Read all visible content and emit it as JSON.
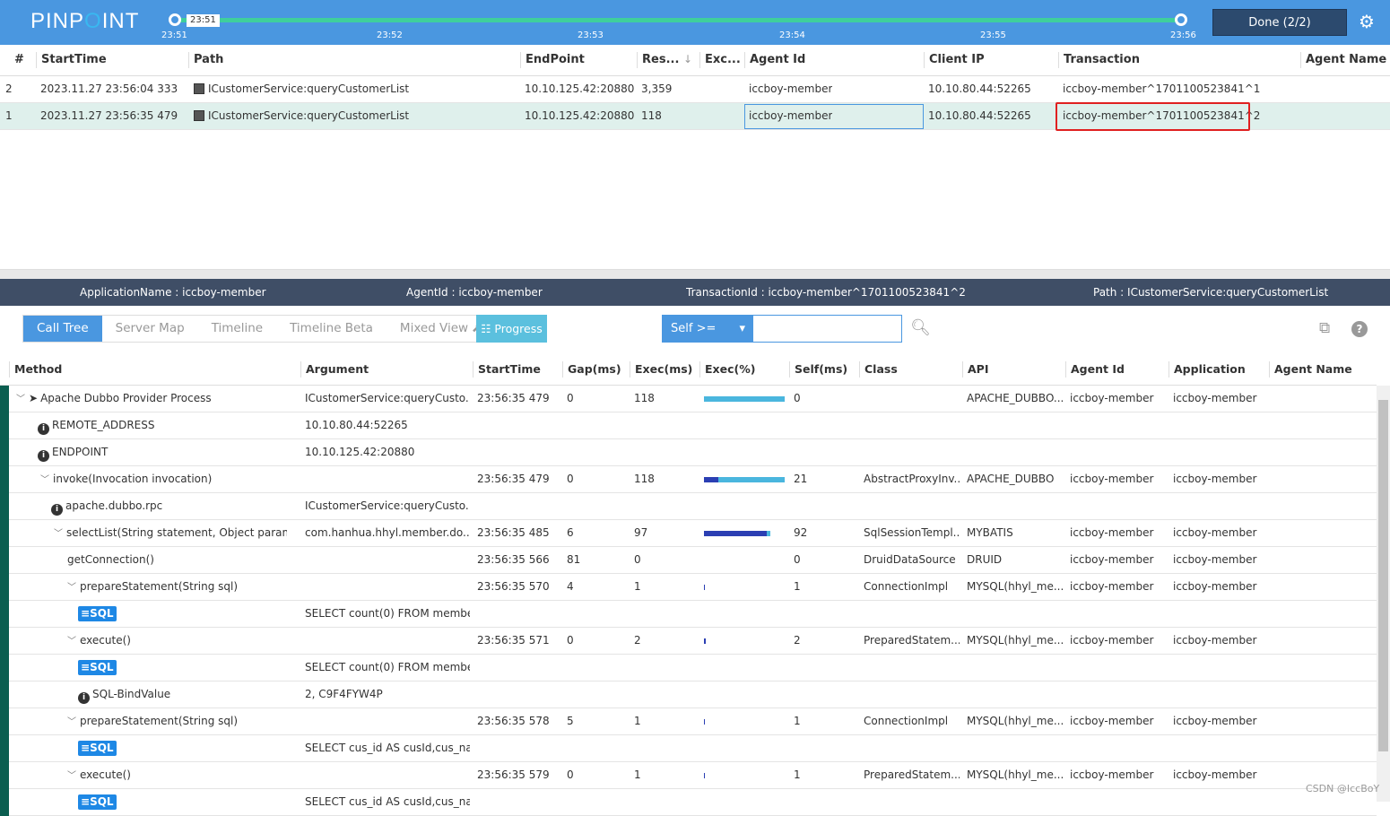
{
  "header": {
    "logo_left": "PINP",
    "logo_o": "O",
    "logo_right": "INT",
    "range_tooltip": "23:51",
    "ticks": [
      "23:51",
      "23:52",
      "23:53",
      "23:54",
      "23:55",
      "23:56"
    ],
    "done_label": "Done (2/2)",
    "accent": "#4a97e0",
    "track_color": "#3fcf9c"
  },
  "list": {
    "columns": [
      "#",
      "StartTime",
      "Path",
      "EndPoint",
      "Res...",
      "Exc...",
      "Agent Id",
      "Client IP",
      "Transaction",
      "Agent Name"
    ],
    "rows": [
      {
        "no": "2",
        "start": "2023.11.27 23:56:04 333",
        "path": "ICustomerService:queryCustomerList",
        "endpoint": "10.10.125.42:20880",
        "res": "3,359",
        "exc": "",
        "agent": "iccboy-member",
        "client": "10.10.80.44:52265",
        "tx": "iccboy-member^1701100523841^1",
        "agentname": ""
      },
      {
        "no": "1",
        "start": "2023.11.27 23:56:35 479",
        "path": "ICustomerService:queryCustomerList",
        "endpoint": "10.10.125.42:20880",
        "res": "118",
        "exc": "",
        "agent": "iccboy-member",
        "client": "10.10.80.44:52265",
        "tx": "iccboy-member^1701100523841^2",
        "agentname": "",
        "selected": true
      }
    ]
  },
  "info": {
    "app": "ApplicationName : iccboy-member",
    "agent": "AgentId : iccboy-member",
    "tx": "TransactionId : iccboy-member^1701100523841^2",
    "path": "Path : ICustomerService:queryCustomerList"
  },
  "tabs": [
    "Call Tree",
    "Server Map",
    "Timeline",
    "Timeline Beta",
    "Mixed View"
  ],
  "progress_label": "Progress",
  "filter": {
    "select": "Self >=",
    "value": ""
  },
  "tree": {
    "columns": [
      "Method",
      "Argument",
      "StartTime",
      "Gap(ms)",
      "Exec(ms)",
      "Exec(%)",
      "Self(ms)",
      "Class",
      "API",
      "Agent Id",
      "Application",
      "Agent Name"
    ],
    "rows": [
      {
        "depth": 0,
        "type": "method",
        "expand": true,
        "icon": "paper-plane",
        "method": "Apache Dubbo Provider Process",
        "arg": "ICustomerService:queryCusto...",
        "start": "23:56:35 479",
        "gap": "0",
        "exec": "118",
        "pct": 100,
        "selfpct": 0,
        "self": "0",
        "cls": "",
        "api": "APACHE_DUBBO...",
        "agent": "iccboy-member",
        "app": "iccboy-member"
      },
      {
        "depth": 2,
        "type": "info",
        "method": "REMOTE_ADDRESS",
        "arg": "10.10.80.44:52265"
      },
      {
        "depth": 2,
        "type": "info",
        "method": "ENDPOINT",
        "arg": "10.10.125.42:20880"
      },
      {
        "depth": 1,
        "type": "method",
        "expand": true,
        "method": "invoke(Invocation invocation)",
        "start": "23:56:35 479",
        "gap": "0",
        "exec": "118",
        "pct": 100,
        "selfpct": 18,
        "self": "21",
        "cls": "AbstractProxyInv...",
        "api": "APACHE_DUBBO",
        "agent": "iccboy-member",
        "app": "iccboy-member"
      },
      {
        "depth": 3,
        "type": "info",
        "method": "apache.dubbo.rpc",
        "arg": "ICustomerService:queryCusto..."
      },
      {
        "depth": 2,
        "type": "method",
        "expand": true,
        "method": "selectList(String statement, Object paramet...",
        "arg": "com.hanhua.hhyl.member.do...",
        "start": "23:56:35 485",
        "gap": "6",
        "exec": "97",
        "pct": 82,
        "selfpct": 78,
        "self": "92",
        "cls": "SqlSessionTempl...",
        "api": "MYBATIS",
        "agent": "iccboy-member",
        "app": "iccboy-member"
      },
      {
        "depth": 3,
        "type": "method",
        "method": "getConnection()",
        "start": "23:56:35 566",
        "gap": "81",
        "exec": "0",
        "pct": 0,
        "selfpct": 0,
        "self": "0",
        "cls": "DruidDataSource",
        "api": "DRUID",
        "agent": "iccboy-member",
        "app": "iccboy-member"
      },
      {
        "depth": 3,
        "type": "method",
        "expand": true,
        "method": "prepareStatement(String sql)",
        "start": "23:56:35 570",
        "gap": "4",
        "exec": "1",
        "pct": 1,
        "selfpct": 1,
        "self": "1",
        "cls": "ConnectionImpl",
        "api": "MYSQL(hhyl_me...",
        "agent": "iccboy-member",
        "app": "iccboy-member"
      },
      {
        "depth": 4,
        "type": "sql",
        "method": "SQL",
        "arg": "SELECT count(0) FROM membe..."
      },
      {
        "depth": 3,
        "type": "method",
        "expand": true,
        "method": "execute()",
        "start": "23:56:35 571",
        "gap": "0",
        "exec": "2",
        "pct": 2,
        "selfpct": 2,
        "self": "2",
        "cls": "PreparedStatem...",
        "api": "MYSQL(hhyl_me...",
        "agent": "iccboy-member",
        "app": "iccboy-member"
      },
      {
        "depth": 4,
        "type": "sql",
        "method": "SQL",
        "arg": "SELECT count(0) FROM membe..."
      },
      {
        "depth": 4,
        "type": "info",
        "method": "SQL-BindValue",
        "arg": "2, C9F4FYW4P"
      },
      {
        "depth": 3,
        "type": "method",
        "expand": true,
        "method": "prepareStatement(String sql)",
        "start": "23:56:35 578",
        "gap": "5",
        "exec": "1",
        "pct": 1,
        "selfpct": 1,
        "self": "1",
        "cls": "ConnectionImpl",
        "api": "MYSQL(hhyl_me...",
        "agent": "iccboy-member",
        "app": "iccboy-member"
      },
      {
        "depth": 4,
        "type": "sql",
        "method": "SQL",
        "arg": "SELECT cus_id AS cusId,cus_na..."
      },
      {
        "depth": 3,
        "type": "method",
        "expand": true,
        "method": "execute()",
        "start": "23:56:35 579",
        "gap": "0",
        "exec": "1",
        "pct": 1,
        "selfpct": 1,
        "self": "1",
        "cls": "PreparedStatem...",
        "api": "MYSQL(hhyl_me...",
        "agent": "iccboy-member",
        "app": "iccboy-member"
      },
      {
        "depth": 4,
        "type": "sql",
        "method": "SQL",
        "arg": "SELECT cus_id AS cusId,cus_na..."
      }
    ]
  },
  "watermark": "CSDN @IccBoY"
}
